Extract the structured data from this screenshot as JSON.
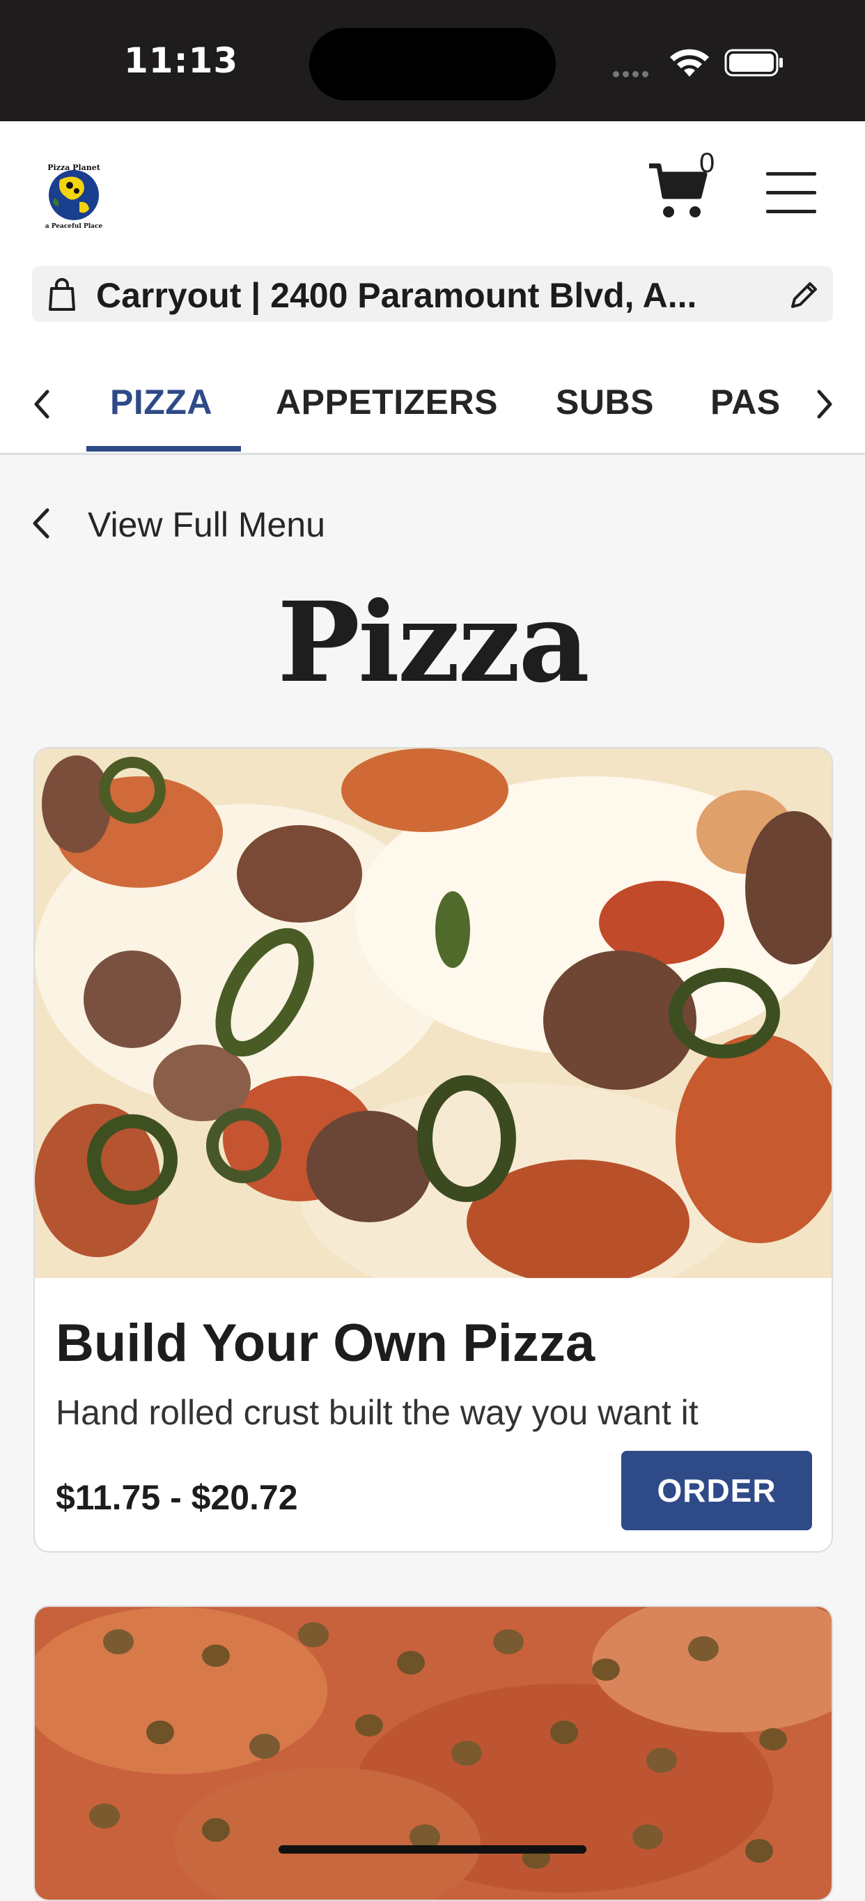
{
  "status_bar": {
    "time": "11:13"
  },
  "header": {
    "logo_top_text": "Pizza Planet",
    "logo_bottom_text": "a Peaceful Place",
    "cart_count": "0",
    "location": "Carryout | 2400 Paramount Blvd, A..."
  },
  "tabs": [
    {
      "label": "PIZZA",
      "active": true
    },
    {
      "label": "APPETIZERS",
      "active": false
    },
    {
      "label": "SUBS",
      "active": false
    },
    {
      "label": "PAS",
      "active": false
    }
  ],
  "back_link": {
    "label": "View Full Menu"
  },
  "page_title": "Pizza",
  "items": [
    {
      "title": "Build Your Own Pizza",
      "description": "Hand rolled crust built the way you want it",
      "price": "$11.75 - $20.72",
      "button": "ORDER"
    }
  ],
  "colors": {
    "accent": "#2e4a87",
    "status_bar": "#1e1c1c",
    "background": "#f6f6f6"
  },
  "icons": [
    "wifi-icon",
    "battery-icon",
    "cart-icon",
    "hamburger-menu-icon",
    "shopping-bag-icon",
    "pencil-icon",
    "chevron-left-icon",
    "chevron-right-icon"
  ]
}
